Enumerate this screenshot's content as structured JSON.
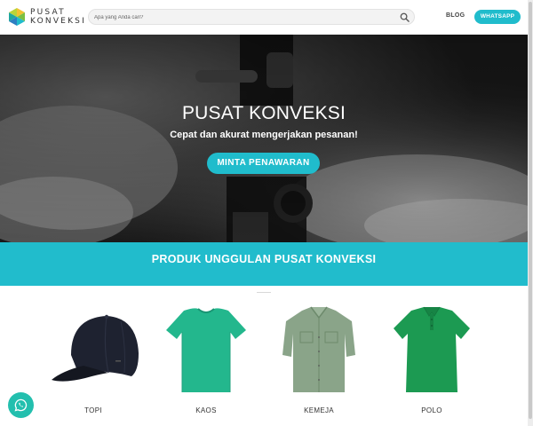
{
  "header": {
    "logo": {
      "line1": "PUSAT",
      "line2": "KONVEKSI",
      "icon": "hexagon-logo-icon",
      "colors": [
        "#f2c230",
        "#7cc042",
        "#20bccc",
        "#2e7fc2"
      ]
    },
    "search": {
      "placeholder": "Apa yang Anda cari?",
      "icon": "search-icon"
    },
    "nav_blog": "BLOG",
    "whatsapp_button": "WHATSAPP"
  },
  "hero": {
    "title": "PUSAT KONVEKSI",
    "subtitle": "Cepat dan akurat mengerjakan pesanan!",
    "cta": "MINTA PENAWARAN"
  },
  "section": {
    "title": "PRODUK UNGGULAN PUSAT KONVEKSI"
  },
  "products": [
    {
      "label": "TOPI",
      "icon": "cap-icon",
      "color": "#1e2230"
    },
    {
      "label": "KAOS",
      "icon": "tshirt-icon",
      "color": "#23b78d"
    },
    {
      "label": "KEMEJA",
      "icon": "shirt-icon",
      "color": "#8aa489"
    },
    {
      "label": "POLO",
      "icon": "polo-icon",
      "color": "#1c9a52"
    }
  ],
  "floating": {
    "icon": "whatsapp-icon"
  },
  "colors": {
    "accent": "#20bccc",
    "banner": "#21bccc",
    "fab": "#23bfae"
  }
}
